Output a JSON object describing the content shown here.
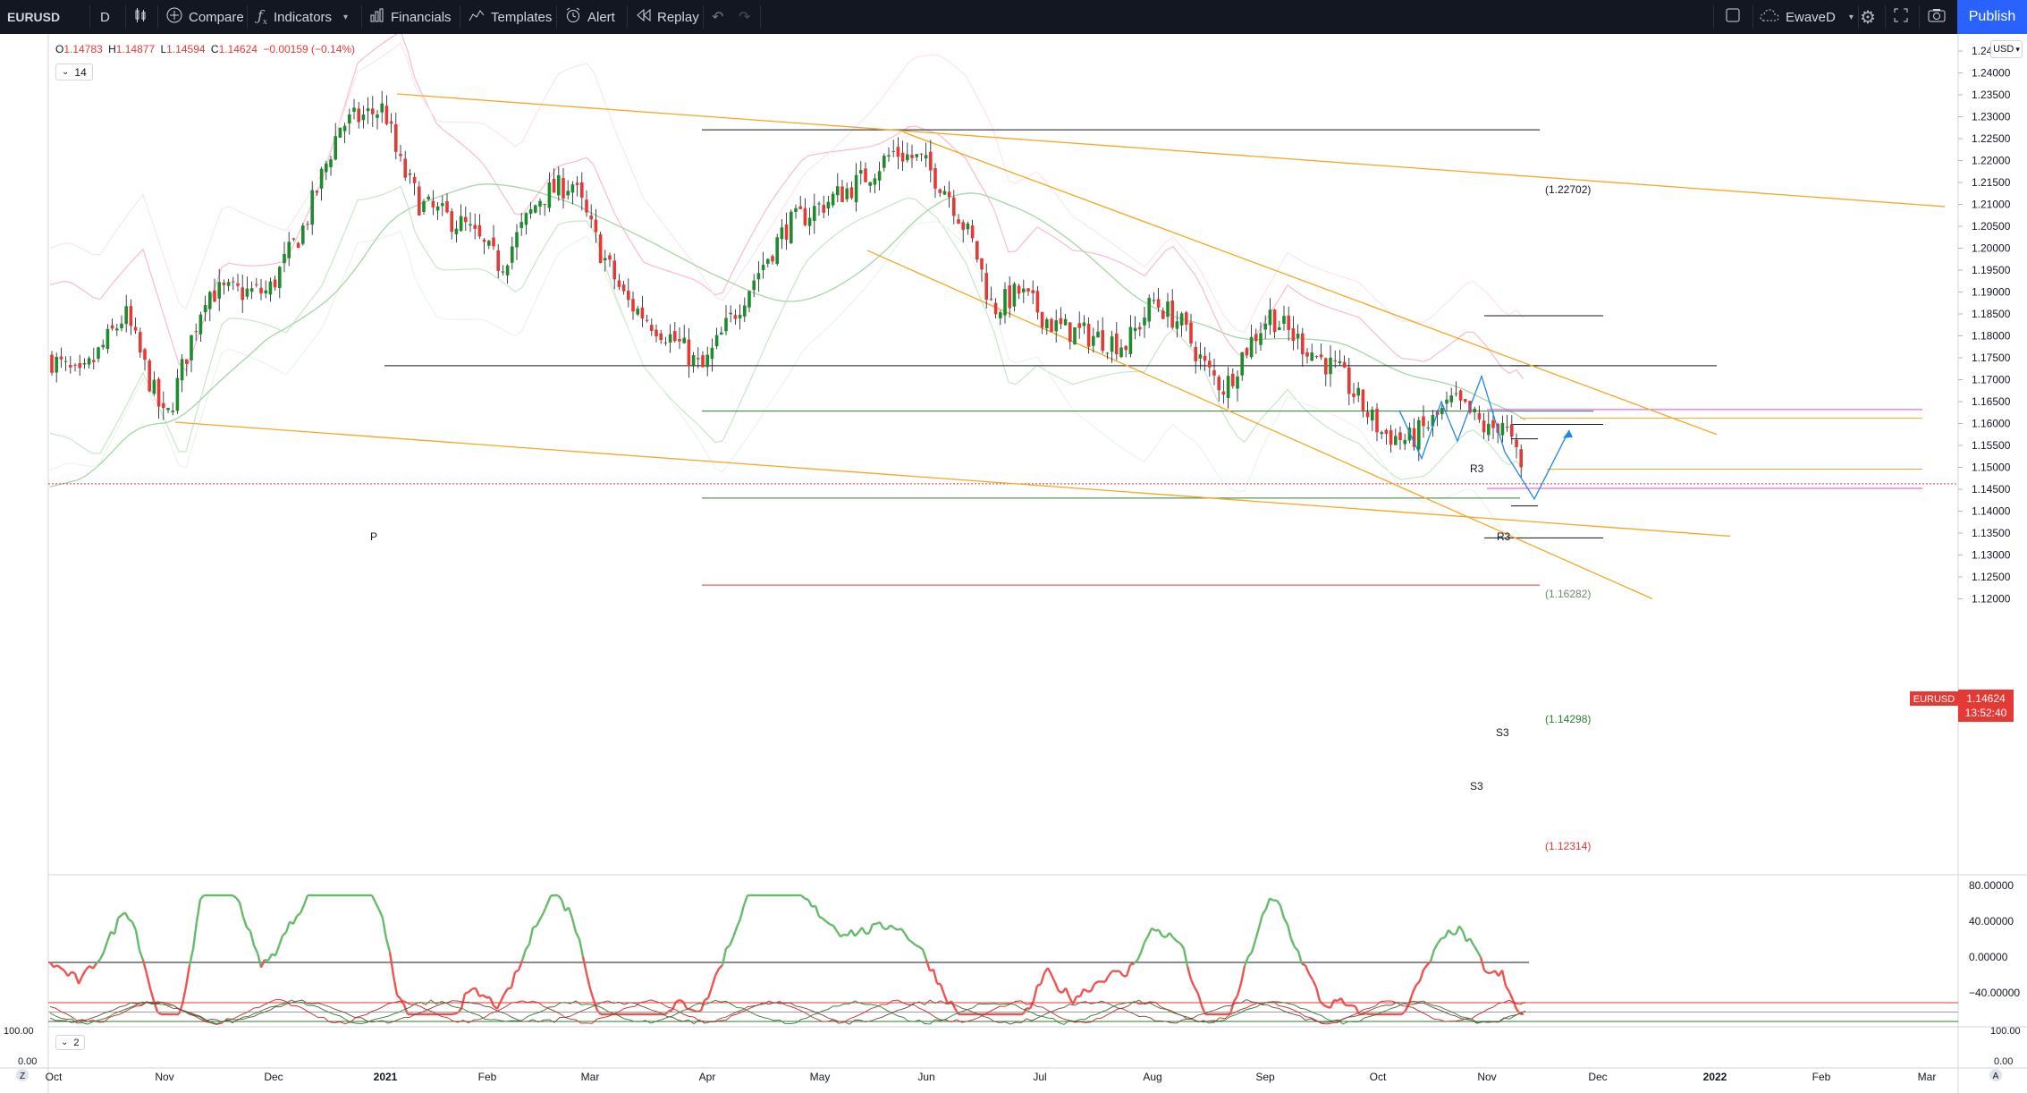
{
  "toolbar": {
    "symbol": "EURUSD",
    "interval": "D",
    "compare": "Compare",
    "indicators": "Indicators",
    "financials": "Financials",
    "templates": "Templates",
    "alert": "Alert",
    "replay": "Replay",
    "layout_name": "EwaveD",
    "publish": "Publish"
  },
  "legend": {
    "o_label": "O",
    "o": "1.14783",
    "h_label": "H",
    "h": "1.14877",
    "l_label": "L",
    "l": "1.14594",
    "c_label": "C",
    "c": "1.14624",
    "change": "−0.00159 (−0.14%)",
    "indicator_param": "14",
    "indicator2_param": "2"
  },
  "price_axis": {
    "currency": "USD",
    "ticks": [
      "1.24500",
      "1.24000",
      "1.23500",
      "1.23000",
      "1.22500",
      "1.22000",
      "1.21500",
      "1.21000",
      "1.20500",
      "1.20000",
      "1.19500",
      "1.19000",
      "1.18500",
      "1.18000",
      "1.17500",
      "1.17000",
      "1.16500",
      "1.16000",
      "1.15500",
      "1.15000",
      "1.14500",
      "1.14000",
      "1.13500",
      "1.13000",
      "1.12500",
      "1.12000"
    ],
    "last_symbol": "EURUSD",
    "last_price": "1.14624",
    "countdown": "13:52:40"
  },
  "osc_axis": {
    "ticks": [
      "80.00000",
      "40.00000",
      "0.00000",
      "−40.00000"
    ]
  },
  "osc2_axis": {
    "ticks": [
      "100.00",
      "0.00"
    ]
  },
  "time_axis": {
    "labels": [
      "Oct",
      "Nov",
      "Dec",
      "2021",
      "Feb",
      "Mar",
      "Apr",
      "May",
      "Jun",
      "Jul",
      "Aug",
      "Sep",
      "Oct",
      "Nov",
      "Dec",
      "2022",
      "Feb",
      "Mar"
    ]
  },
  "drawing_labels": {
    "level_1": "(1.22702)",
    "level_2": "(1.16282)",
    "level_3": "(1.14298)",
    "level_4": "(1.12314)",
    "pivot": "P",
    "r3_a": "R3",
    "r3_b": "R3",
    "s3_a": "S3",
    "s3_b": "S3"
  },
  "colors": {
    "bull": "#26a69a",
    "bull_candle": "#1e8b2d",
    "bear_candle": "#e53935",
    "trendline": "#f5a623",
    "pink_band": "#f8bbd0",
    "green_band": "#b9dfc0",
    "accent": "#2962ff",
    "toolbar_bg": "#131722"
  },
  "chart_data": {
    "type": "candlestick",
    "symbol": "EURUSD",
    "interval": "D",
    "ylim": [
      1.1175,
      1.2475
    ],
    "key_levels": [
      1.22702,
      1.16282,
      1.14298,
      1.12314
    ],
    "last": 1.14624
  }
}
